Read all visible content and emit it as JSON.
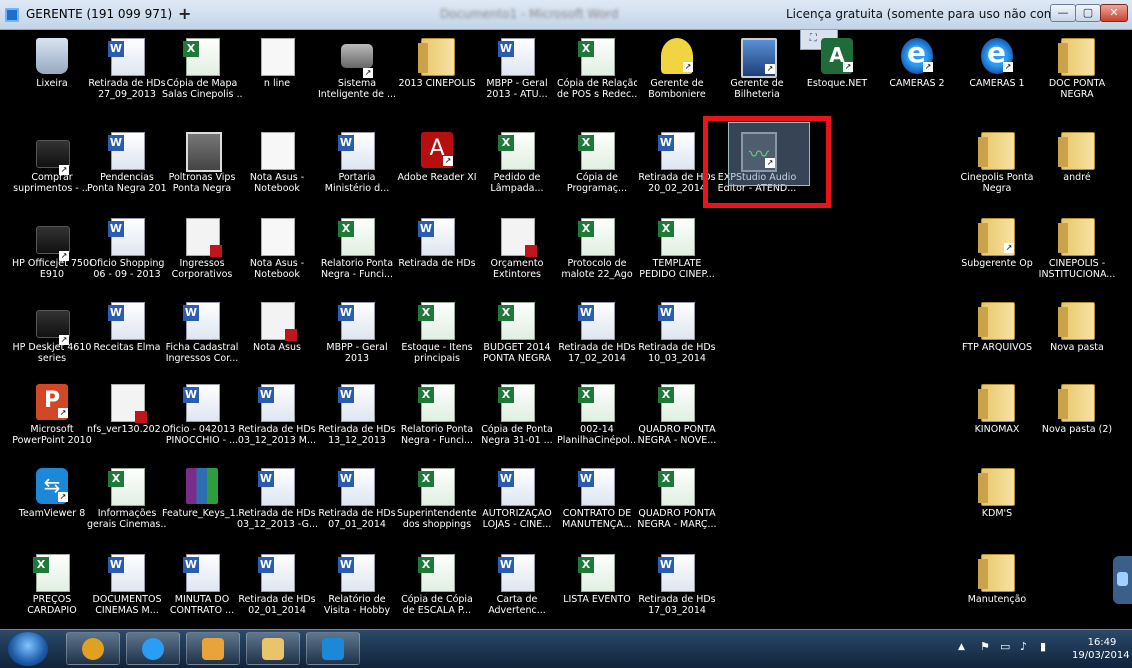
{
  "titlebar": {
    "connection": "GERENTE (191 099 971)",
    "add_tab": "+",
    "document_title": "Documento1 - Microsoft Word",
    "license": "Licença gratuita (somente para uso não comercial)",
    "min": "—",
    "max": "▢",
    "close": "✕",
    "overlay": "⛶ ⌄"
  },
  "icons": [
    {
      "id": "lixeira",
      "glyph": "recycle",
      "shortcut": false,
      "lines": [
        "Lixeira"
      ]
    },
    {
      "id": "retirada-hds-27-09",
      "glyph": "word",
      "shortcut": false,
      "lines": [
        "Retirada de HDs",
        "27_09_2013"
      ]
    },
    {
      "id": "copia-mapa-salas",
      "glyph": "excel",
      "shortcut": false,
      "lines": [
        "Cópia de Mapa",
        "Salas Cinepolis ..."
      ]
    },
    {
      "id": "n-line",
      "glyph": "doc",
      "shortcut": false,
      "lines": [
        "n line"
      ]
    },
    {
      "id": "sistema-inteligente",
      "glyph": "camera",
      "shortcut": true,
      "lines": [
        "Sistema",
        "Inteligente de ..."
      ]
    },
    {
      "id": "2013-cinepolis",
      "glyph": "folder",
      "shortcut": false,
      "lines": [
        "2013 CINEPOLIS"
      ]
    },
    {
      "id": "mbpp-geral-2013-atu",
      "glyph": "word",
      "shortcut": false,
      "lines": [
        "MBPP - Geral",
        "2013 - ATU..."
      ]
    },
    {
      "id": "copia-relacao-pos",
      "glyph": "excel",
      "shortcut": false,
      "lines": [
        "Cópia de Relação",
        "de POS s Redec..."
      ]
    },
    {
      "id": "gerente-bomboniere",
      "glyph": "bomb",
      "shortcut": true,
      "lines": [
        "Gerente de",
        "Bomboniere"
      ]
    },
    {
      "id": "gerente-bilheteria",
      "glyph": "monitor",
      "shortcut": true,
      "lines": [
        "Gerente de",
        "Bilheteria"
      ]
    },
    {
      "id": "estoque-net",
      "glyph": "estoque",
      "shortcut": true,
      "lines": [
        "Estoque.NET"
      ]
    },
    {
      "id": "cameras-2",
      "glyph": "ie",
      "shortcut": true,
      "lines": [
        "CAMERAS 2"
      ]
    },
    {
      "id": "cameras-1",
      "glyph": "ie",
      "shortcut": true,
      "lines": [
        "CAMERAS 1"
      ]
    },
    {
      "id": "doc-ponta-negra",
      "glyph": "folder",
      "shortcut": false,
      "lines": [
        "DOC PONTA",
        "NEGRA"
      ]
    },
    {
      "id": "comprar-suprimentos",
      "glyph": "printer",
      "shortcut": true,
      "lines": [
        "Comprar",
        "suprimentos - ..."
      ]
    },
    {
      "id": "pendencias-ponta-negra",
      "glyph": "word",
      "shortcut": false,
      "lines": [
        "Pendencias",
        "Ponta Negra 2013"
      ]
    },
    {
      "id": "poltronas-vips",
      "glyph": "photo",
      "shortcut": false,
      "lines": [
        "Poltronas Vips",
        "Ponta Negra"
      ]
    },
    {
      "id": "nota-asus-notebook-1",
      "glyph": "doc",
      "shortcut": false,
      "lines": [
        "Nota Asus -",
        "Notebook"
      ]
    },
    {
      "id": "portaria-ministerio",
      "glyph": "word",
      "shortcut": false,
      "lines": [
        "Portaria",
        "Ministério d..."
      ]
    },
    {
      "id": "adobe-reader",
      "glyph": "adobe",
      "shortcut": true,
      "lines": [
        "Adobe Reader XI"
      ]
    },
    {
      "id": "pedido-lampada",
      "glyph": "excel",
      "shortcut": false,
      "lines": [
        "Pedido de",
        "Lâmpada..."
      ]
    },
    {
      "id": "copia-programac",
      "glyph": "excel",
      "shortcut": false,
      "lines": [
        "Cópia de",
        "Programaç..."
      ]
    },
    {
      "id": "retirada-hds-20-02",
      "glyph": "word",
      "shortcut": false,
      "lines": [
        "Retirada de HDs",
        "20_02_2014"
      ]
    },
    {
      "id": "expstudio-audio",
      "glyph": "wav",
      "shortcut": true,
      "lines": [
        "EXPStudio Audio",
        "Editor - ATEND..."
      ]
    },
    {
      "id": "cinepolis-ponta-negra",
      "glyph": "folder",
      "shortcut": false,
      "lines": [
        "Cinepolis Ponta",
        "Negra"
      ]
    },
    {
      "id": "andre",
      "glyph": "folder",
      "shortcut": false,
      "lines": [
        "andré"
      ]
    },
    {
      "id": "hp-officejet-7500",
      "glyph": "printer",
      "shortcut": true,
      "lines": [
        "HP Officejet 7500",
        "E910"
      ]
    },
    {
      "id": "oficio-shopping",
      "glyph": "word",
      "shortcut": false,
      "lines": [
        "Oficio Shopping",
        "06 - 09 - 2013"
      ]
    },
    {
      "id": "ingressos-corporativos",
      "glyph": "pdf",
      "shortcut": false,
      "lines": [
        "Ingressos",
        "Corporativos"
      ]
    },
    {
      "id": "nota-asus-notebook-2",
      "glyph": "doc",
      "shortcut": false,
      "lines": [
        "Nota Asus -",
        "Notebook"
      ]
    },
    {
      "id": "relatorio-ponta-negra-1",
      "glyph": "excel",
      "shortcut": false,
      "lines": [
        "Relatorio Ponta",
        "Negra - Funci..."
      ]
    },
    {
      "id": "retirada-hds",
      "glyph": "word",
      "shortcut": false,
      "lines": [
        "Retirada de HDs"
      ]
    },
    {
      "id": "orcamento-extintores",
      "glyph": "pdf",
      "shortcut": false,
      "lines": [
        "Orçamento",
        "Extintores"
      ]
    },
    {
      "id": "protocolo-malote",
      "glyph": "excel",
      "shortcut": false,
      "lines": [
        "Protocolo de",
        "malote 22_Ago"
      ]
    },
    {
      "id": "template-pedido",
      "glyph": "excel",
      "shortcut": false,
      "lines": [
        "TEMPLATE",
        "PEDIDO CINEP..."
      ]
    },
    {
      "id": "subgerente-op",
      "glyph": "folder",
      "shortcut": true,
      "lines": [
        "Subgerente Op"
      ]
    },
    {
      "id": "cinepolis-institucional",
      "glyph": "folder",
      "shortcut": false,
      "lines": [
        "CINEPOLIS -",
        "INSTITUCIONA..."
      ]
    },
    {
      "id": "hp-deskjet-4610",
      "glyph": "printer",
      "shortcut": true,
      "lines": [
        "HP Deskjet 4610",
        "series"
      ]
    },
    {
      "id": "receitas-elma",
      "glyph": "word",
      "shortcut": false,
      "lines": [
        "Receitas Elma"
      ]
    },
    {
      "id": "ficha-cadastral",
      "glyph": "word",
      "shortcut": false,
      "lines": [
        "Ficha Cadastral",
        "Ingressos Cor..."
      ]
    },
    {
      "id": "nota-asus",
      "glyph": "pdf",
      "shortcut": false,
      "lines": [
        "Nota Asus"
      ]
    },
    {
      "id": "mbpp-geral-2013",
      "glyph": "word",
      "shortcut": false,
      "lines": [
        "MBPP - Geral",
        "2013"
      ]
    },
    {
      "id": "estoque-itens",
      "glyph": "excel",
      "shortcut": false,
      "lines": [
        "Estoque - Itens",
        "principais"
      ]
    },
    {
      "id": "budget-2014",
      "glyph": "excel",
      "shortcut": false,
      "lines": [
        "BUDGET 2014",
        "PONTA NEGRA"
      ]
    },
    {
      "id": "retirada-hds-17-02",
      "glyph": "word",
      "shortcut": false,
      "lines": [
        "Retirada de HDs",
        "17_02_2014"
      ]
    },
    {
      "id": "retirada-hds-10-03",
      "glyph": "word",
      "shortcut": false,
      "lines": [
        "Retirada de HDs",
        "10_03_2014"
      ]
    },
    {
      "id": "ftp-arquivos",
      "glyph": "folder",
      "shortcut": false,
      "lines": [
        "FTP ARQUIVOS"
      ]
    },
    {
      "id": "nova-pasta",
      "glyph": "folder",
      "shortcut": false,
      "lines": [
        "Nova pasta"
      ]
    },
    {
      "id": "powerpoint-2010",
      "glyph": "ppt",
      "shortcut": true,
      "lines": [
        "Microsoft",
        "PowerPoint 2010"
      ]
    },
    {
      "id": "nfs-ver130",
      "glyph": "pdf",
      "shortcut": false,
      "lines": [
        "nfs_ver130.202..."
      ]
    },
    {
      "id": "oficio-042013",
      "glyph": "word",
      "shortcut": false,
      "lines": [
        "Oficio - 042013 -",
        "PINOCCHIO - ..."
      ]
    },
    {
      "id": "retirada-hds-03-12-m",
      "glyph": "word",
      "shortcut": false,
      "lines": [
        "Retirada de HDs",
        "03_12_2013 M..."
      ]
    },
    {
      "id": "retirada-hds-13-12",
      "glyph": "word",
      "shortcut": false,
      "lines": [
        "Retirada de HDs",
        "13_12_2013"
      ]
    },
    {
      "id": "relatorio-ponta-negra-2",
      "glyph": "excel",
      "shortcut": false,
      "lines": [
        "Relatorio Ponta",
        "Negra - Funci..."
      ]
    },
    {
      "id": "copia-ponta-negra",
      "glyph": "excel",
      "shortcut": false,
      "lines": [
        "Cópia de Ponta",
        "Negra 31-01 ..."
      ]
    },
    {
      "id": "planilha-cinepol",
      "glyph": "excel",
      "shortcut": false,
      "lines": [
        "002-14",
        "PlanilhaCinépol..."
      ]
    },
    {
      "id": "quadro-ponta-negra-nov",
      "glyph": "excel",
      "shortcut": false,
      "lines": [
        "QUADRO PONTA",
        "NEGRA - NOVE..."
      ]
    },
    {
      "id": "kinomax",
      "glyph": "folder",
      "shortcut": false,
      "lines": [
        "KINOMAX"
      ]
    },
    {
      "id": "nova-pasta-2",
      "glyph": "folder",
      "shortcut": false,
      "lines": [
        "Nova pasta (2)"
      ]
    },
    {
      "id": "teamviewer-8",
      "glyph": "tv",
      "shortcut": true,
      "lines": [
        "TeamViewer 8"
      ]
    },
    {
      "id": "informacoes-gerais",
      "glyph": "excel",
      "shortcut": false,
      "lines": [
        "Informações",
        "gerais Cinemas..."
      ]
    },
    {
      "id": "feature-keys",
      "glyph": "rar",
      "shortcut": false,
      "lines": [
        "Feature_Keys_1..."
      ]
    },
    {
      "id": "retirada-hds-03-12-g",
      "glyph": "word",
      "shortcut": false,
      "lines": [
        "Retirada de HDs",
        "03_12_2013 -G..."
      ]
    },
    {
      "id": "retirada-hds-07-01",
      "glyph": "word",
      "shortcut": false,
      "lines": [
        "Retirada de HDs",
        "07_01_2014"
      ]
    },
    {
      "id": "superintendentes",
      "glyph": "excel",
      "shortcut": false,
      "lines": [
        "Superintendentes",
        "dos shoppings"
      ]
    },
    {
      "id": "autorizacao-lojas",
      "glyph": "word",
      "shortcut": false,
      "lines": [
        "AUTORIZAÇÃO",
        "LOJAS - CINE..."
      ]
    },
    {
      "id": "contrato-manutencao",
      "glyph": "word",
      "shortcut": false,
      "lines": [
        "CONTRATO DE",
        "MANUTENÇÃ..."
      ]
    },
    {
      "id": "quadro-ponta-negra-mar",
      "glyph": "excel",
      "shortcut": false,
      "lines": [
        "QUADRO PONTA",
        "NEGRA - MARÇ..."
      ]
    },
    {
      "id": "kdms",
      "glyph": "folder",
      "shortcut": false,
      "lines": [
        "KDM'S"
      ]
    },
    {
      "id": "precos-cardapio",
      "glyph": "excel",
      "shortcut": false,
      "lines": [
        "PREÇOS",
        "CARDAPIO"
      ]
    },
    {
      "id": "documentos-cinemas",
      "glyph": "word",
      "shortcut": false,
      "lines": [
        "DOCUMENTOS",
        "CINEMAS M..."
      ]
    },
    {
      "id": "minuta-contrato",
      "glyph": "word",
      "shortcut": false,
      "lines": [
        "MINUTA DO",
        "CONTRATO ..."
      ]
    },
    {
      "id": "retirada-hds-02-01",
      "glyph": "word",
      "shortcut": false,
      "lines": [
        "Retirada de HDs",
        "02_01_2014"
      ]
    },
    {
      "id": "relatorio-visita",
      "glyph": "word",
      "shortcut": false,
      "lines": [
        "Relatório de",
        "Visita - Hobby"
      ]
    },
    {
      "id": "copia-escala",
      "glyph": "excel",
      "shortcut": false,
      "lines": [
        "Cópia de Cópia",
        "de ESCALA P..."
      ]
    },
    {
      "id": "carta-advertenc",
      "glyph": "word",
      "shortcut": false,
      "lines": [
        "Carta de",
        "Advertenc..."
      ]
    },
    {
      "id": "lista-evento",
      "glyph": "excel",
      "shortcut": false,
      "lines": [
        "LISTA EVENTO"
      ]
    },
    {
      "id": "retirada-hds-17-03",
      "glyph": "word",
      "shortcut": false,
      "lines": [
        "Retirada de HDs",
        "17_03_2014"
      ]
    },
    {
      "id": "manutencao",
      "glyph": "folder",
      "shortcut": false,
      "lines": [
        "Manutenção"
      ]
    }
  ],
  "taskbar": {
    "items": [
      {
        "id": "chrome",
        "color": "#e0a020"
      },
      {
        "id": "internet-explorer",
        "color": "#2a9df4"
      },
      {
        "id": "outlook",
        "color": "#e8a43a"
      },
      {
        "id": "file-explorer",
        "color": "#e9c46a"
      },
      {
        "id": "teamviewer",
        "color": "#1e88d8"
      }
    ],
    "tray_arrow": "▲",
    "time": "16:49",
    "date": "19/03/2014"
  },
  "colors": {
    "highlight": "#e8141a",
    "desktop": "#000000"
  }
}
